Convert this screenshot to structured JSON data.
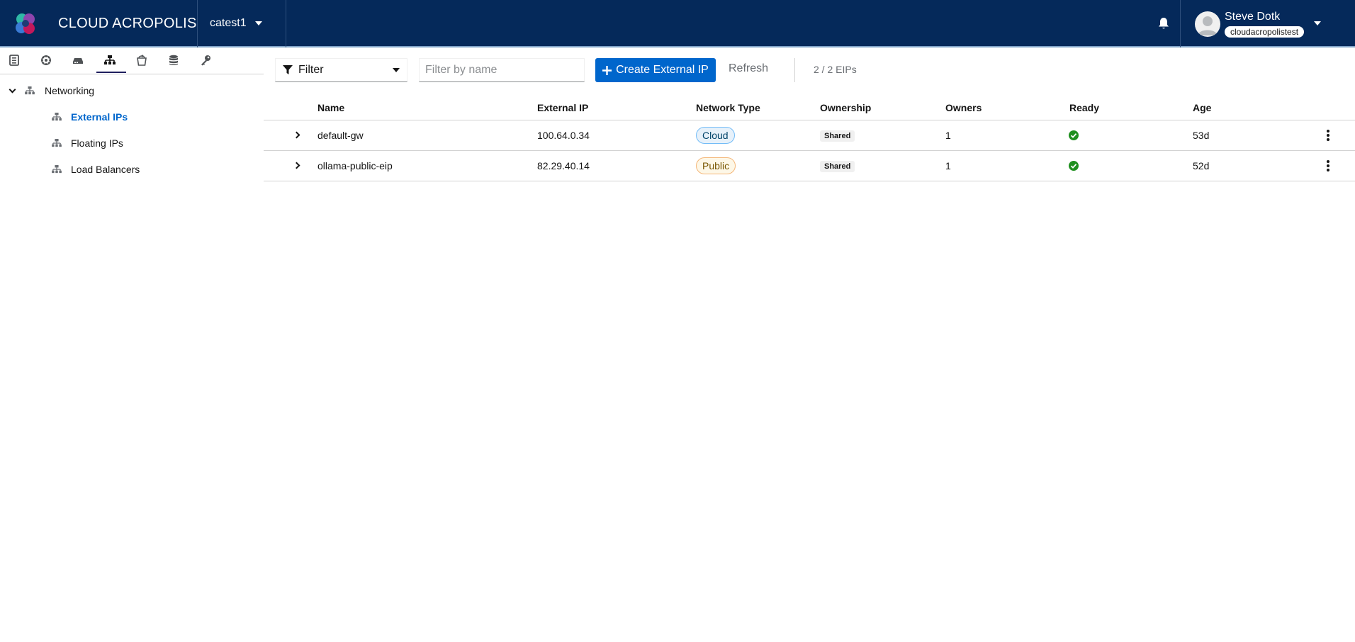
{
  "header": {
    "brand": "CLOUD ACROPOLIS",
    "project": "catest1",
    "user_name": "Steve Dotk",
    "user_org": "cloudacropolistest",
    "accent": "#05295a"
  },
  "sidebar": {
    "icons": [
      "document-icon",
      "cluster-icon",
      "server-icon",
      "network-icon",
      "bucket-icon",
      "database-icon",
      "key-icon"
    ],
    "active_icon": "network-icon",
    "tree": {
      "root": "Networking",
      "items": [
        {
          "label": "External IPs",
          "active": true
        },
        {
          "label": "Floating IPs",
          "active": false
        },
        {
          "label": "Load Balancers",
          "active": false
        }
      ]
    }
  },
  "toolbar": {
    "filter_label": "Filter",
    "search_placeholder": "Filter by name",
    "create_label": "Create External IP",
    "refresh_label": "Refresh",
    "count": "2 / 2 EIPs"
  },
  "table": {
    "columns": [
      "Name",
      "External IP",
      "Network Type",
      "Ownership",
      "Owners",
      "Ready",
      "Age"
    ],
    "rows": [
      {
        "name": "default-gw",
        "ip": "100.64.0.34",
        "network_type": "Cloud",
        "ownership": "Shared",
        "owners": "1",
        "ready": true,
        "age": "53d"
      },
      {
        "name": "ollama-public-eip",
        "ip": "82.29.40.14",
        "network_type": "Public",
        "ownership": "Shared",
        "owners": "1",
        "ready": true,
        "age": "52d"
      }
    ]
  }
}
